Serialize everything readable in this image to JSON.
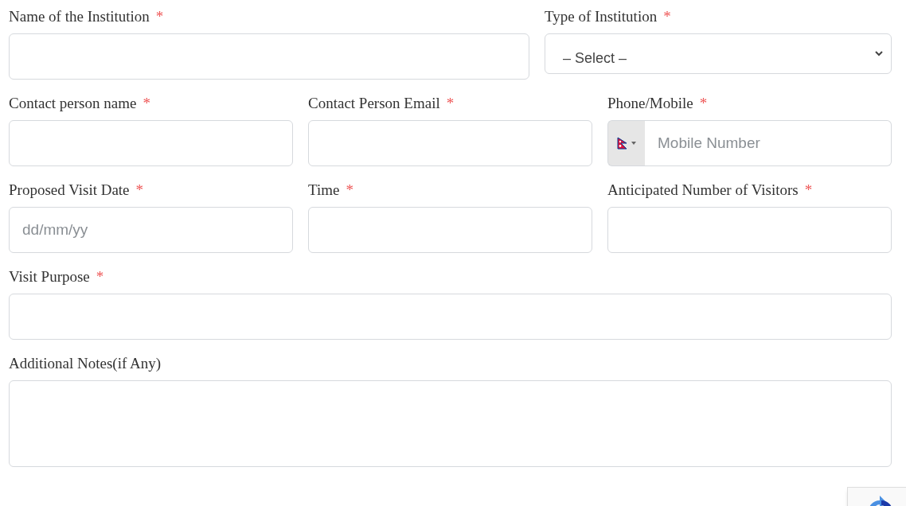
{
  "rows": [
    [
      {
        "kind": "text",
        "label": "Name of the Institution",
        "required": true
      },
      {
        "kind": "select",
        "label": "Type of Institution",
        "required": true,
        "value": "– Select –"
      }
    ],
    [
      {
        "kind": "text",
        "label": "Contact person name",
        "required": true
      },
      {
        "kind": "text",
        "label": "Contact Person Email",
        "required": true
      },
      {
        "kind": "phone",
        "label": "Phone/Mobile",
        "required": true,
        "placeholder": "Mobile Number"
      }
    ],
    [
      {
        "kind": "text",
        "label": "Proposed Visit Date",
        "required": true,
        "placeholder": "dd/mm/yy"
      },
      {
        "kind": "text",
        "label": "Time",
        "required": true
      },
      {
        "kind": "text",
        "label": "Anticipated Number of Visitors",
        "required": true
      }
    ],
    [
      {
        "kind": "text",
        "label": "Visit Purpose",
        "required": true
      }
    ],
    [
      {
        "kind": "textarea",
        "label": "Additional Notes(if Any)",
        "required": false
      }
    ]
  ],
  "asterisk": "*"
}
